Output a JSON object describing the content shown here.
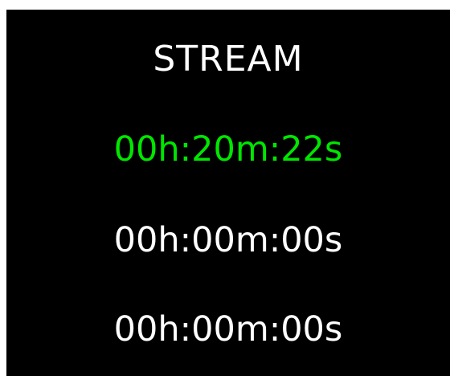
{
  "colors": {
    "background": "#000000",
    "text": "#ffffff",
    "active": "#00e600"
  },
  "title": "STREAM",
  "timers": [
    {
      "value": "00h:20m:22s",
      "active": true
    },
    {
      "value": "00h:00m:00s",
      "active": false
    },
    {
      "value": "00h:00m:00s",
      "active": false
    }
  ]
}
